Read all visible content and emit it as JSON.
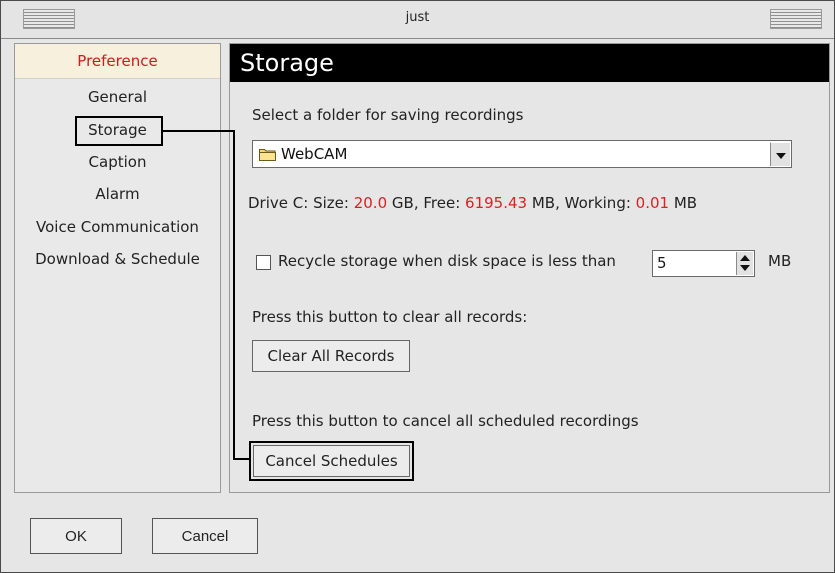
{
  "window": {
    "title": "just"
  },
  "sidebar": {
    "header": "Preference",
    "items": [
      {
        "label": "General"
      },
      {
        "label": "Storage"
      },
      {
        "label": "Caption"
      },
      {
        "label": "Alarm"
      },
      {
        "label": "Voice Communication"
      },
      {
        "label": "Download & Schedule"
      }
    ]
  },
  "content": {
    "title": "Storage",
    "folder_prompt": "Select a folder for saving recordings",
    "folder_value": "WebCAM",
    "drive": {
      "label": "Drive C:",
      "size_label": "Size:",
      "size_value": "20.0",
      "size_unit": "GB,",
      "free_label": "Free:",
      "free_value": "6195.43",
      "free_unit": "MB,",
      "working_label": "Working:",
      "working_value": "0.01",
      "working_unit": "MB"
    },
    "recycle": {
      "label": "Recycle storage when disk space is less than",
      "value": "5",
      "unit": "MB",
      "checked": false
    },
    "clear_prompt": "Press this button to clear all records:",
    "clear_button": "Clear All Records",
    "cancel_prompt": "Press this button to cancel all scheduled recordings",
    "cancel_button": "Cancel Schedules"
  },
  "footer": {
    "ok_label": "OK",
    "cancel_label": "Cancel"
  },
  "colors": {
    "accent_red": "#e01f1f",
    "header_black": "#000000",
    "sidebar_header_bg": "#f6f0dc"
  }
}
